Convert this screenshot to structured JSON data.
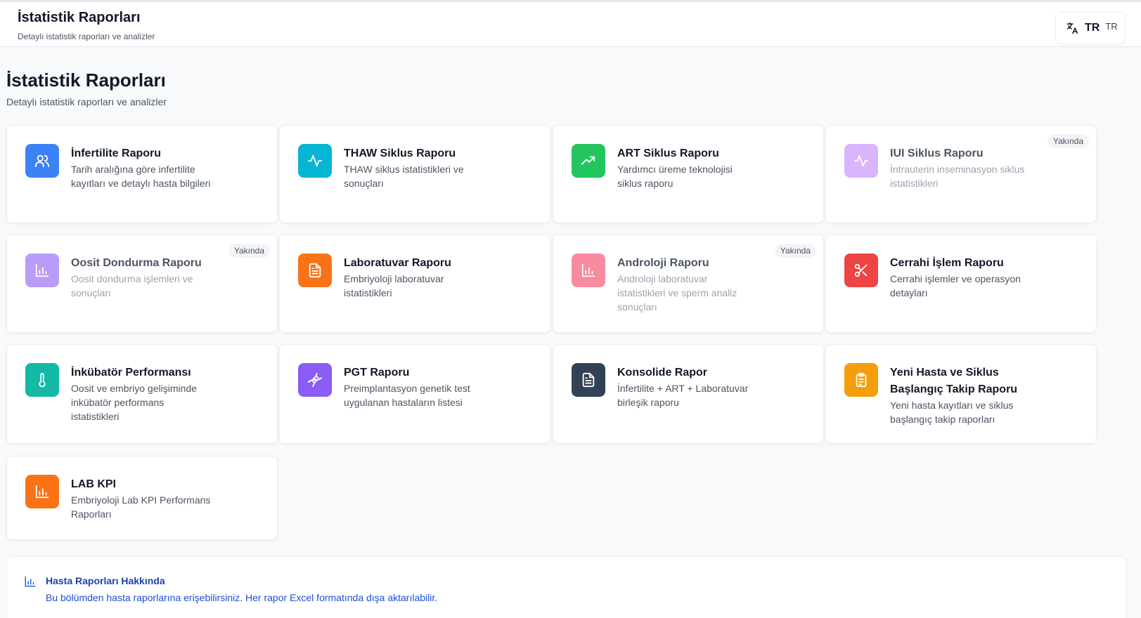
{
  "header": {
    "title": "İstatistik Raporları",
    "subtitle": "Detaylı istatistik raporları ve analizler",
    "language": {
      "icon": "translate-icon",
      "code": "TR",
      "code_secondary": "TR"
    }
  },
  "page": {
    "title": "İstatistik Raporları",
    "subtitle": "Detaylı istatistik raporları ve analizler"
  },
  "cards": [
    {
      "title": "İnfertilite Raporu",
      "description": "Tarih aralığına göre infertilite kayıtları ve detaylı hasta bilgileri",
      "icon": "users-icon",
      "color": "#3b82f6",
      "badge": ""
    },
    {
      "title": "THAW Siklus Raporu",
      "description": "THAW siklus istatistikleri ve sonuçları",
      "icon": "activity-icon",
      "color": "#06b6d4",
      "badge": ""
    },
    {
      "title": "ART Siklus Raporu",
      "description": "Yardımcı üreme teknolojisi siklus raporu",
      "icon": "trending-up-icon",
      "color": "#22c55e",
      "badge": ""
    },
    {
      "title": "IUI Siklus Raporu",
      "description": "İntrauterin inseminasyon siklus istatistikleri",
      "icon": "activity-icon",
      "color": "#c084fc",
      "badge": "Yakında"
    },
    {
      "title": "Oosit Dondurma Raporu",
      "description": "Oosit dondurma işlemleri ve sonuçları",
      "icon": "bar-chart-icon",
      "color": "#8b5cf6",
      "badge": "Yakında"
    },
    {
      "title": "Laboratuvar Raporu",
      "description": "Embriyoloji laboratuvar istatistikleri",
      "icon": "document-icon",
      "color": "#f97316",
      "badge": ""
    },
    {
      "title": "Androloji Raporu",
      "description": "Androloji laboratuvar istatistikleri ve sperm analiz sonuçları",
      "icon": "bar-chart-icon",
      "color": "#f43f5e",
      "badge": "Yakında"
    },
    {
      "title": "Cerrahi İşlem Raporu",
      "description": "Cerrahi işlemler ve operasyon detayları",
      "icon": "scissors-icon",
      "color": "#ef4444",
      "badge": ""
    },
    {
      "title": "İnkübatör Performansı",
      "description": "Oosit ve embriyo gelişiminde inkübatör performans istatistikleri",
      "icon": "thermometer-icon",
      "color": "#14b8a6",
      "badge": ""
    },
    {
      "title": "PGT Raporu",
      "description": "Preimplantasyon genetik test uygulanan hastaların listesi",
      "icon": "dna-icon",
      "color": "#8b5cf6",
      "badge": ""
    },
    {
      "title": "Konsolide Rapor",
      "description": "İnfertilite + ART + Laboratuvar birleşik raporu",
      "icon": "document-icon",
      "color": "#334155",
      "badge": ""
    },
    {
      "title": "Yeni Hasta ve Siklus Başlangıç Takip Raporu",
      "description": "Yeni hasta kayıtları ve siklus başlangıç takip raporları",
      "icon": "clipboard-icon",
      "color": "#f59e0b",
      "badge": ""
    },
    {
      "title": "LAB KPI",
      "description": "Embriyoloji Lab KPI Performans Raporları",
      "icon": "bar-chart-icon",
      "color": "#f97316",
      "badge": ""
    }
  ],
  "info": {
    "icon": "bar-chart-icon",
    "title": "Hasta Raporları Hakkında",
    "text": "Bu bölümden hasta raporlarına erişebilirsiniz. Her rapor Excel formatında dışa aktarılabilir."
  }
}
